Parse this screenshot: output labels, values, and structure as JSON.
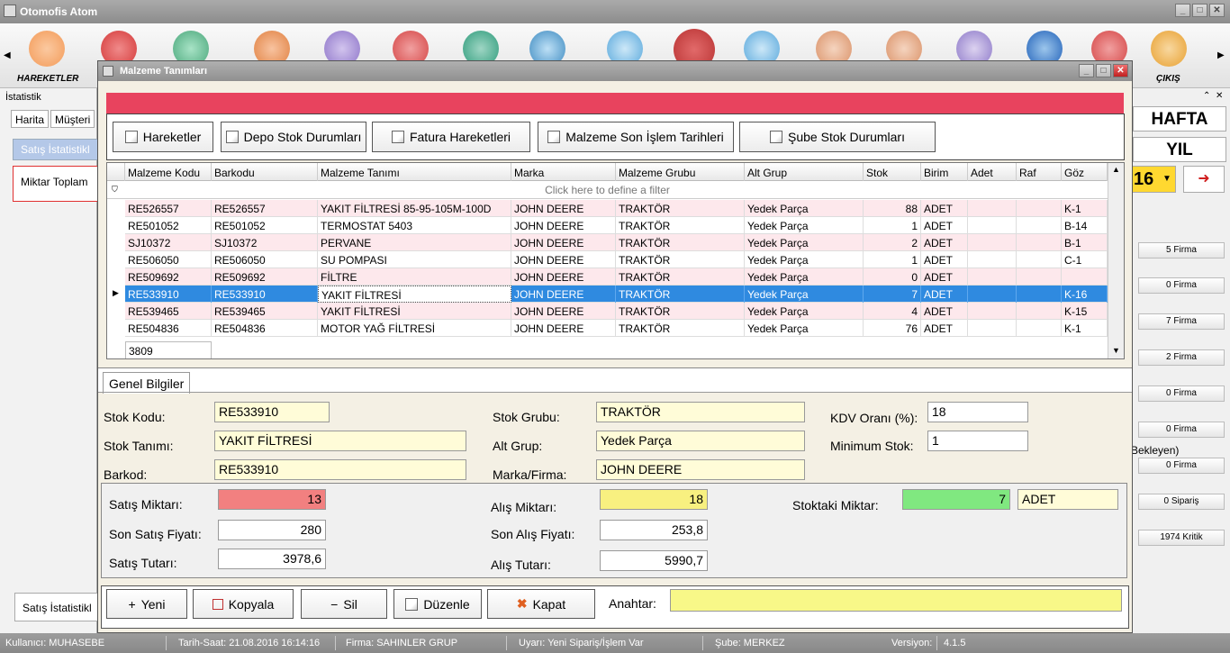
{
  "app": {
    "title": "Otomofis Atom"
  },
  "toolbar": {
    "label_hareketler": "HAREKETLER",
    "label_cikis": "ÇIKIŞ"
  },
  "left": {
    "panel_title": "İstatistik",
    "tab_harita": "Harita",
    "tab_musteri": "Müşteri",
    "box1": "Satış İstatistikl",
    "box2": "Miktar Toplam",
    "bottom_tab": "Satış İstatistikl"
  },
  "right": {
    "hafta": "HAFTA",
    "yil": "YIL",
    "num": "16",
    "bekleyen": "Bekleyen)",
    "stats": [
      "5 Firma",
      "0 Firma",
      "7 Firma",
      "2 Firma",
      "0 Firma",
      "0 Firma",
      "0 Firma",
      "0 Sipariş",
      "1974 Kritik"
    ]
  },
  "dialog": {
    "title": "Malzeme Tanımları",
    "buttons": [
      "Hareketler",
      "Depo Stok Durumları",
      "Fatura Hareketleri",
      "Malzeme Son İşlem Tarihleri",
      "Şube Stok Durumları"
    ],
    "grid": {
      "columns": [
        "Malzeme Kodu",
        "Barkodu",
        "Malzeme Tanımı",
        "Marka",
        "Malzeme Grubu",
        "Alt Grup",
        "Stok",
        "Birim",
        "Adet",
        "Raf",
        "Göz"
      ],
      "filter_text": "Click here to define a filter",
      "rows": [
        [
          "RE526557",
          "RE526557",
          "YAKIT FİLTRESİ 85-95-105M-100D",
          "JOHN DEERE",
          "TRAKTÖR",
          "Yedek Parça",
          "88",
          "ADET",
          "",
          "",
          "K-1"
        ],
        [
          "RE501052",
          "RE501052",
          "TERMOSTAT 5403",
          "JOHN DEERE",
          "TRAKTÖR",
          "Yedek Parça",
          "1",
          "ADET",
          "",
          "",
          "B-14"
        ],
        [
          "SJ10372",
          "SJ10372",
          "PERVANE",
          "JOHN DEERE",
          "TRAKTÖR",
          "Yedek Parça",
          "2",
          "ADET",
          "",
          "",
          "B-1"
        ],
        [
          "RE506050",
          "RE506050",
          "SU POMPASI",
          "JOHN DEERE",
          "TRAKTÖR",
          "Yedek Parça",
          "1",
          "ADET",
          "",
          "",
          "C-1"
        ],
        [
          "RE509692",
          "RE509692",
          "FİLTRE",
          "JOHN DEERE",
          "TRAKTÖR",
          "Yedek Parça",
          "0",
          "ADET",
          "",
          "",
          ""
        ],
        [
          "RE533910",
          "RE533910",
          "YAKIT FİLTRESİ",
          "JOHN DEERE",
          "TRAKTÖR",
          "Yedek Parça",
          "7",
          "ADET",
          "",
          "",
          "K-16"
        ],
        [
          "RE539465",
          "RE539465",
          "YAKIT FİLTRESİ",
          "JOHN DEERE",
          "TRAKTÖR",
          "Yedek Parça",
          "4",
          "ADET",
          "",
          "",
          "K-15"
        ],
        [
          "RE504836",
          "RE504836",
          "MOTOR YAĞ FİLTRESİ",
          "JOHN DEERE",
          "TRAKTÖR",
          "Yedek Parça",
          "76",
          "ADET",
          "",
          "",
          "K-1"
        ]
      ],
      "selected_row": 5,
      "row_count": "3809"
    },
    "tab": "Genel Bilgiler",
    "form": {
      "stok_kodu_label": "Stok Kodu:",
      "stok_kodu": "RE533910",
      "stok_tanimi_label": "Stok Tanımı:",
      "stok_tanimi": "YAKIT FİLTRESİ",
      "barkod_label": "Barkod:",
      "barkod": "RE533910",
      "stok_grubu_label": "Stok Grubu:",
      "stok_grubu": "TRAKTÖR",
      "alt_grup_label": "Alt Grup:",
      "alt_grup": "Yedek Parça",
      "marka_label": "Marka/Firma:",
      "marka": "JOHN DEERE",
      "kdv_label": "KDV Oranı (%):",
      "kdv": "18",
      "min_stok_label": "Minimum Stok:",
      "min_stok": "1"
    },
    "stats": {
      "satis_miktari_label": "Satış Miktarı:",
      "satis_miktari": "13",
      "son_satis_label": "Son Satış Fiyatı:",
      "son_satis": "280",
      "satis_tutari_label": "Satış Tutarı:",
      "satis_tutari": "3978,6",
      "alis_miktari_label": "Alış Miktarı:",
      "alis_miktari": "18",
      "son_alis_label": "Son Alış Fiyatı:",
      "son_alis": "253,8",
      "alis_tutari_label": "Alış Tutarı:",
      "alis_tutari": "5990,7",
      "stoktaki_label": "Stoktaki Miktar:",
      "stoktaki": "7",
      "birim": "ADET"
    },
    "bottom": {
      "yeni": "Yeni",
      "kopyala": "Kopyala",
      "sil": "Sil",
      "duzenle": "Düzenle",
      "kapat": "Kapat",
      "anahtar_label": "Anahtar:",
      "anahtar": ""
    }
  },
  "status": {
    "kullanici": "Kullanıcı: MUHASEBE",
    "tarih": "Tarih-Saat: 21.08.2016 16:14:16",
    "firma": "Firma: SAHINLER GRUP",
    "uyari": "Uyarı: Yeni Sipariş/İşlem Var",
    "sube": "Şube: MERKEZ",
    "versiyon_label": "Versiyon:",
    "versiyon": "4.1.5"
  },
  "colors": {
    "accent_red": "#e8435e",
    "selection": "#2f8ae0",
    "field_yellow": "#fffcd8",
    "sales_red": "#f28080",
    "buy_yellow": "#f8f080",
    "stock_green": "#80e880"
  }
}
